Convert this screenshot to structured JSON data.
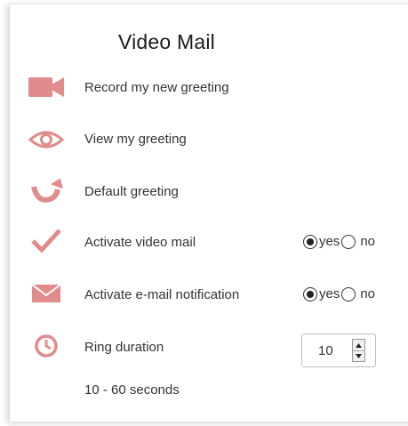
{
  "title": "Video Mail",
  "accent_color": "#e08c8c",
  "rows": [
    {
      "icon": "video-camera-icon",
      "label": "Record my new greeting"
    },
    {
      "icon": "eye-icon",
      "label": "View my greeting"
    },
    {
      "icon": "undo-arrow-icon",
      "label": "Default greeting"
    },
    {
      "icon": "checkmark-icon",
      "label": "Activate video mail"
    },
    {
      "icon": "envelope-icon",
      "label": "Activate e-mail notification"
    },
    {
      "icon": "clock-icon",
      "label": "Ring duration"
    }
  ],
  "activate_video_mail": {
    "yes_label": "yes",
    "no_label": "no",
    "selected": "yes"
  },
  "activate_email_notification": {
    "yes_label": "yes",
    "no_label": "no",
    "selected": "yes"
  },
  "ring_duration": {
    "value": "10",
    "range_text": "10 - 60 seconds"
  }
}
